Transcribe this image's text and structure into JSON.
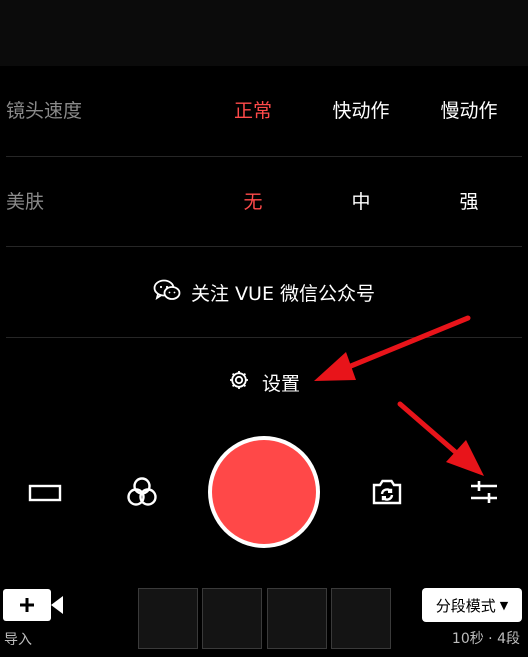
{
  "speed": {
    "label": "镜头速度",
    "options": [
      "正常",
      "快动作",
      "慢动作"
    ],
    "selected": "正常"
  },
  "beauty": {
    "label": "美肤",
    "options": [
      "无",
      "中",
      "强"
    ],
    "selected": "无"
  },
  "follow": {
    "label": "关注 VUE 微信公众号"
  },
  "settings": {
    "label": "设置"
  },
  "bottom": {
    "import_label": "导入",
    "mode_label": "分段模式",
    "mode_info": "10秒 · 4段",
    "segment_count": 4
  },
  "icons": {
    "aspect": "aspect-ratio-icon",
    "filter": "filter-circles-icon",
    "flip": "camera-flip-icon",
    "adjust": "adjust-sliders-icon",
    "wechat": "wechat-icon",
    "gear": "gear-icon",
    "add_video": "add-video-icon"
  },
  "colors": {
    "accent": "#ff4848",
    "arrow": "#e8141a",
    "background": "#000000",
    "muted": "#8a8a8a"
  }
}
